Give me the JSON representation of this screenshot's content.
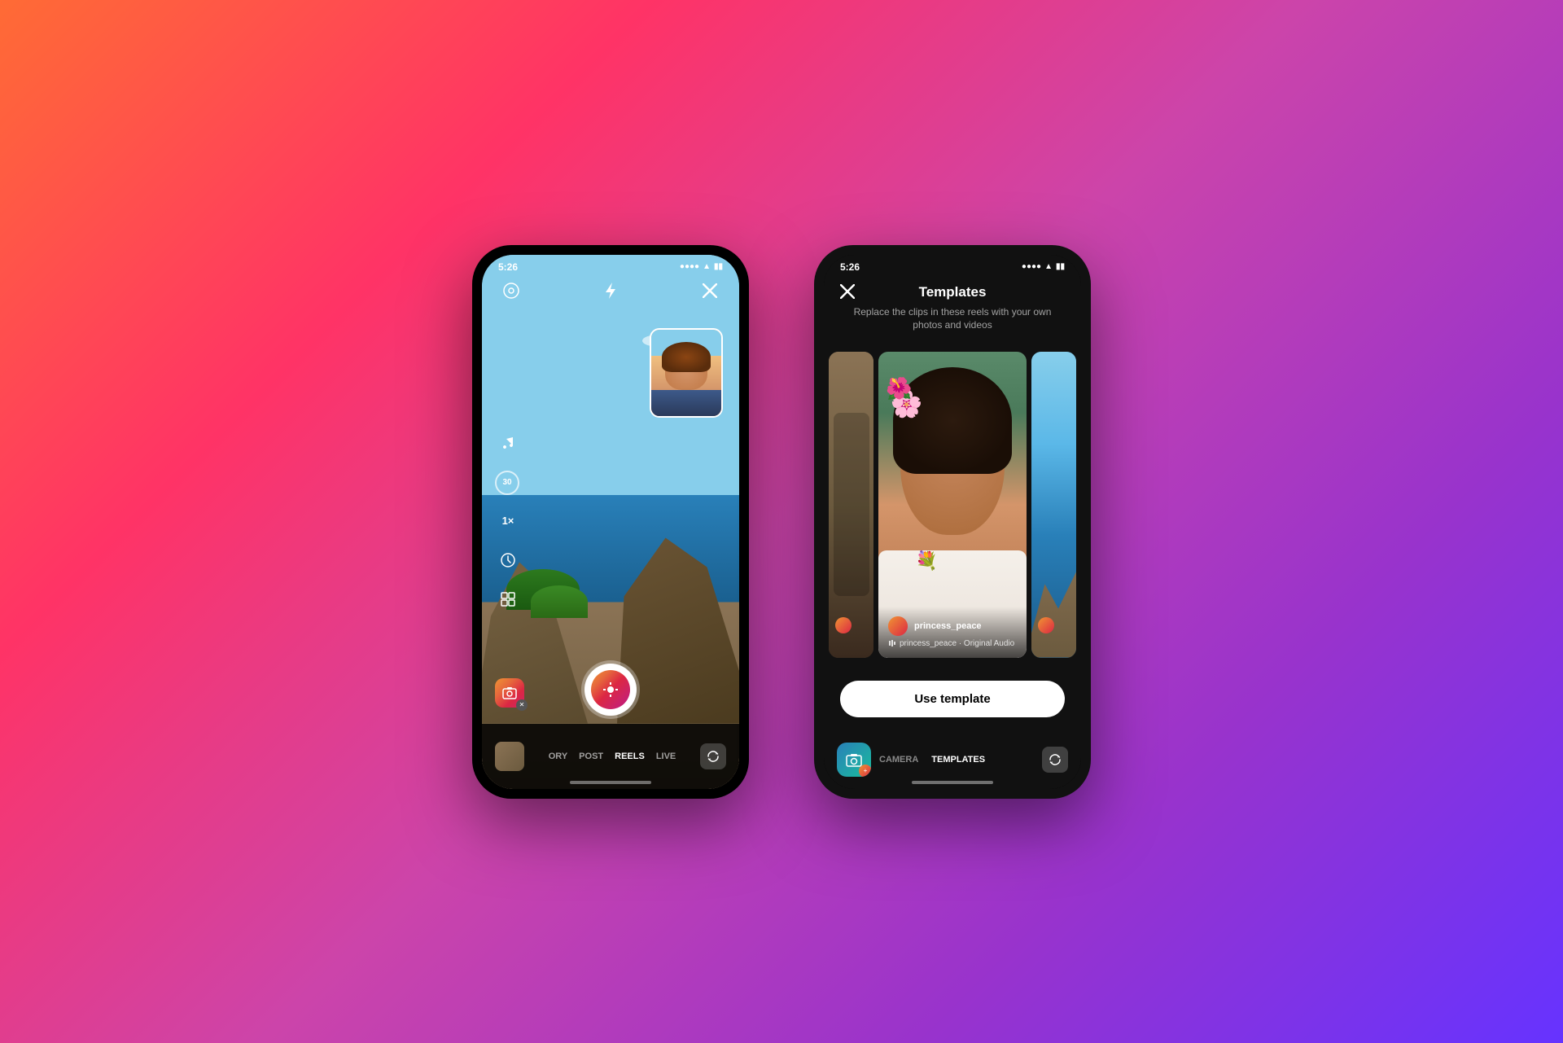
{
  "background": {
    "gradient": "linear-gradient(135deg, #ff6b35 0%, #ff3366 25%, #cc44aa 50%, #9933cc 75%, #6633ff 100%)"
  },
  "phone1": {
    "status_time": "5:26",
    "screen": "camera",
    "nav_tabs": [
      "ORY",
      "POST",
      "REELS",
      "LIVE"
    ],
    "active_tab": "REELS",
    "icons": {
      "settings": "⊙",
      "flash": "⚡",
      "close": "✕",
      "music": "♫",
      "timer": "30",
      "speed": "1×",
      "clock": "⏱",
      "layout": "⊞",
      "camera_app": "📷"
    }
  },
  "phone2": {
    "status_time": "5:26",
    "screen": "templates",
    "header": {
      "close_icon": "✕",
      "title": "Templates",
      "subtitle": "Replace the clips in these reels with your own photos and videos"
    },
    "template_card": {
      "username": "princess_peace",
      "audio_label": "princess_peace · Original Audio"
    },
    "use_template_label": "Use template",
    "nav_tabs": [
      "CAMERA",
      "TEMPLATES"
    ],
    "active_tab": "TEMPLATES"
  }
}
